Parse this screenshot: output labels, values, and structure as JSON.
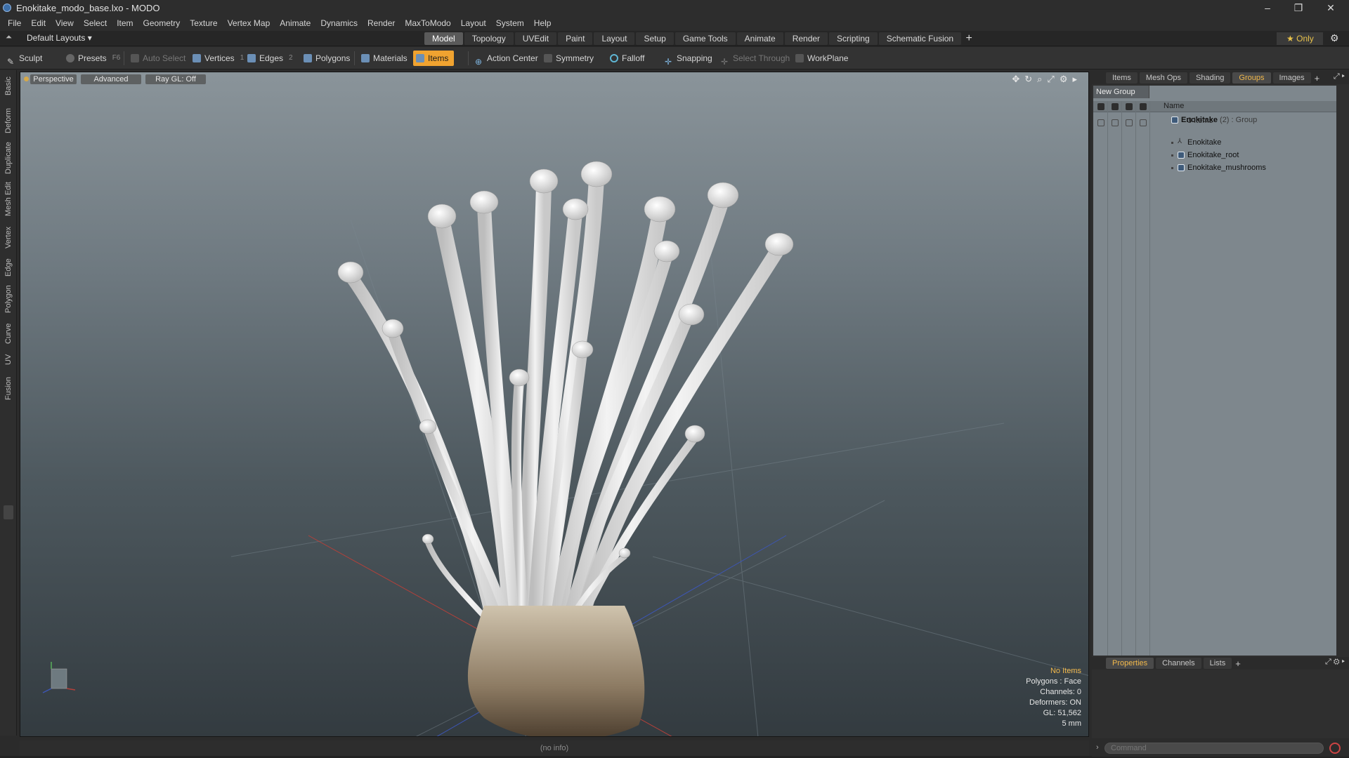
{
  "window": {
    "title": "Enokitake_modo_base.lxo - MODO",
    "controls": [
      "–",
      "❐",
      "✕"
    ]
  },
  "menu": [
    "File",
    "Edit",
    "View",
    "Select",
    "Item",
    "Geometry",
    "Texture",
    "Vertex Map",
    "Animate",
    "Dynamics",
    "Render",
    "MaxToModo",
    "Layout",
    "System",
    "Help"
  ],
  "layoutbar": {
    "layouts_label": "Default Layouts ▾",
    "tabs": [
      "Model",
      "Topology",
      "UVEdit",
      "Paint",
      "Layout",
      "Setup",
      "Game Tools",
      "Animate",
      "Render",
      "Scripting",
      "Schematic Fusion"
    ],
    "active_tab": "Model",
    "add": "+",
    "only_label": "Only",
    "star": "★"
  },
  "toolbar": {
    "sculpt": "Sculpt",
    "presets": "Presets",
    "presets_key": "F6",
    "auto_select": "Auto Select",
    "vertices": "Vertices",
    "vertices_key": "1",
    "edges": "Edges",
    "edges_key": "2",
    "polygons": "Polygons",
    "materials": "Materials",
    "items": "Items",
    "action_center": "Action Center",
    "symmetry": "Symmetry",
    "falloff": "Falloff",
    "snapping": "Snapping",
    "select_through": "Select Through",
    "workplane": "WorkPlane"
  },
  "left_tabs": [
    "Basic",
    "Deform",
    "Duplicate",
    "Mesh Edit",
    "Vertex",
    "Edge",
    "Polygon",
    "Curve",
    "UV",
    "Fusion"
  ],
  "viewport": {
    "view_mode": "Perspective",
    "style": "Advanced",
    "raygl": "Ray GL: Off",
    "info": {
      "selection": "No Items",
      "polygons": "Polygons : Face",
      "channels": "Channels: 0",
      "deformers": "Deformers: ON",
      "gl": "GL: 51,562",
      "grid": "5 mm"
    }
  },
  "status": "(no info)",
  "right_panel": {
    "top_tabs": [
      "Items",
      "Mesh Ops",
      "Shading",
      "Groups",
      "Images"
    ],
    "active_top_tab": "Groups",
    "new_group": "New Group",
    "name_header": "Name",
    "group": {
      "name": "Enokitake",
      "meta": " (2) : Group",
      "sub": "3 Items",
      "children": [
        "Enokitake",
        "Enokitake_root",
        "Enokitake_mushrooms"
      ]
    },
    "bottom_tabs": [
      "Properties",
      "Channels",
      "Lists"
    ],
    "active_bottom_tab": "Properties",
    "command_placeholder": "Command"
  },
  "colors": {
    "accent_orange": "#f0a330",
    "accent_yellow": "#f1b84b",
    "viewport_top": "#8a949a",
    "viewport_bottom": "#333b40"
  }
}
